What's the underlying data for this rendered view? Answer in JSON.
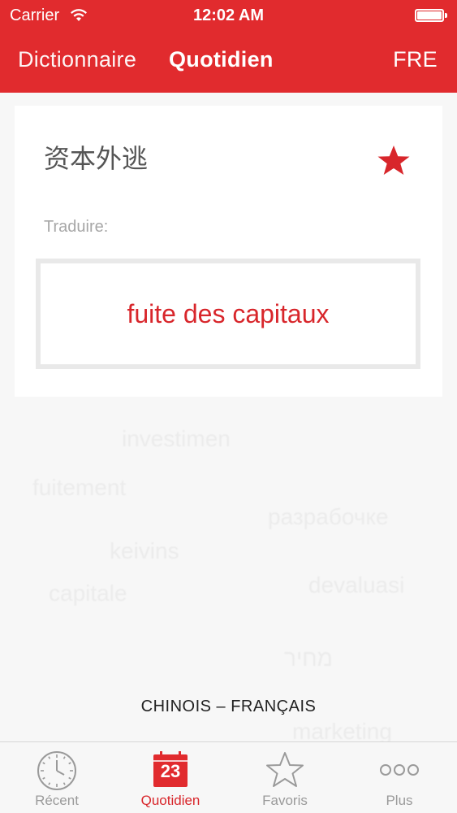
{
  "status": {
    "carrier": "Carrier",
    "time": "12:02 AM"
  },
  "nav": {
    "dictionary": "Dictionnaire",
    "daily": "Quotidien",
    "language": "FRE"
  },
  "card": {
    "word": "资本外逃",
    "favorite_icon": "star-filled-icon",
    "translate_label": "Traduire:",
    "translation": "fuite des capitaux"
  },
  "language_pair": "CHINOIS – FRANÇAIS",
  "tabs": [
    {
      "label": "Récent",
      "icon": "clock-icon"
    },
    {
      "label": "Quotidien",
      "icon": "calendar-icon",
      "day": "23",
      "active": true
    },
    {
      "label": "Favoris",
      "icon": "star-outline-icon"
    },
    {
      "label": "Plus",
      "icon": "more-dots-icon"
    }
  ],
  "colors": {
    "accent": "#e12b2e",
    "translation": "#d8262b",
    "inactive": "#9a9a9a"
  }
}
